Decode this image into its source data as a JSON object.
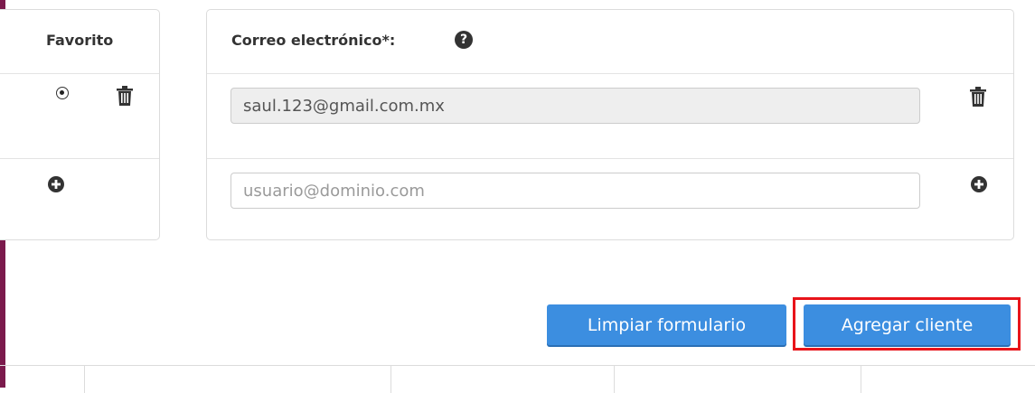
{
  "left_panel": {
    "header": "Favorito"
  },
  "email_panel": {
    "header": "Correo electrónico*:",
    "help_glyph": "?",
    "email_value": "saul.123@gmail.com.mx",
    "new_email_placeholder": "usuario@dominio.com"
  },
  "actions": {
    "clear_label": "Limpiar formulario",
    "add_label": "Agregar cliente"
  },
  "colors": {
    "accent_bar": "#7b1a4c",
    "button_blue": "#3c8ee0",
    "highlight_red": "#e8141a"
  }
}
